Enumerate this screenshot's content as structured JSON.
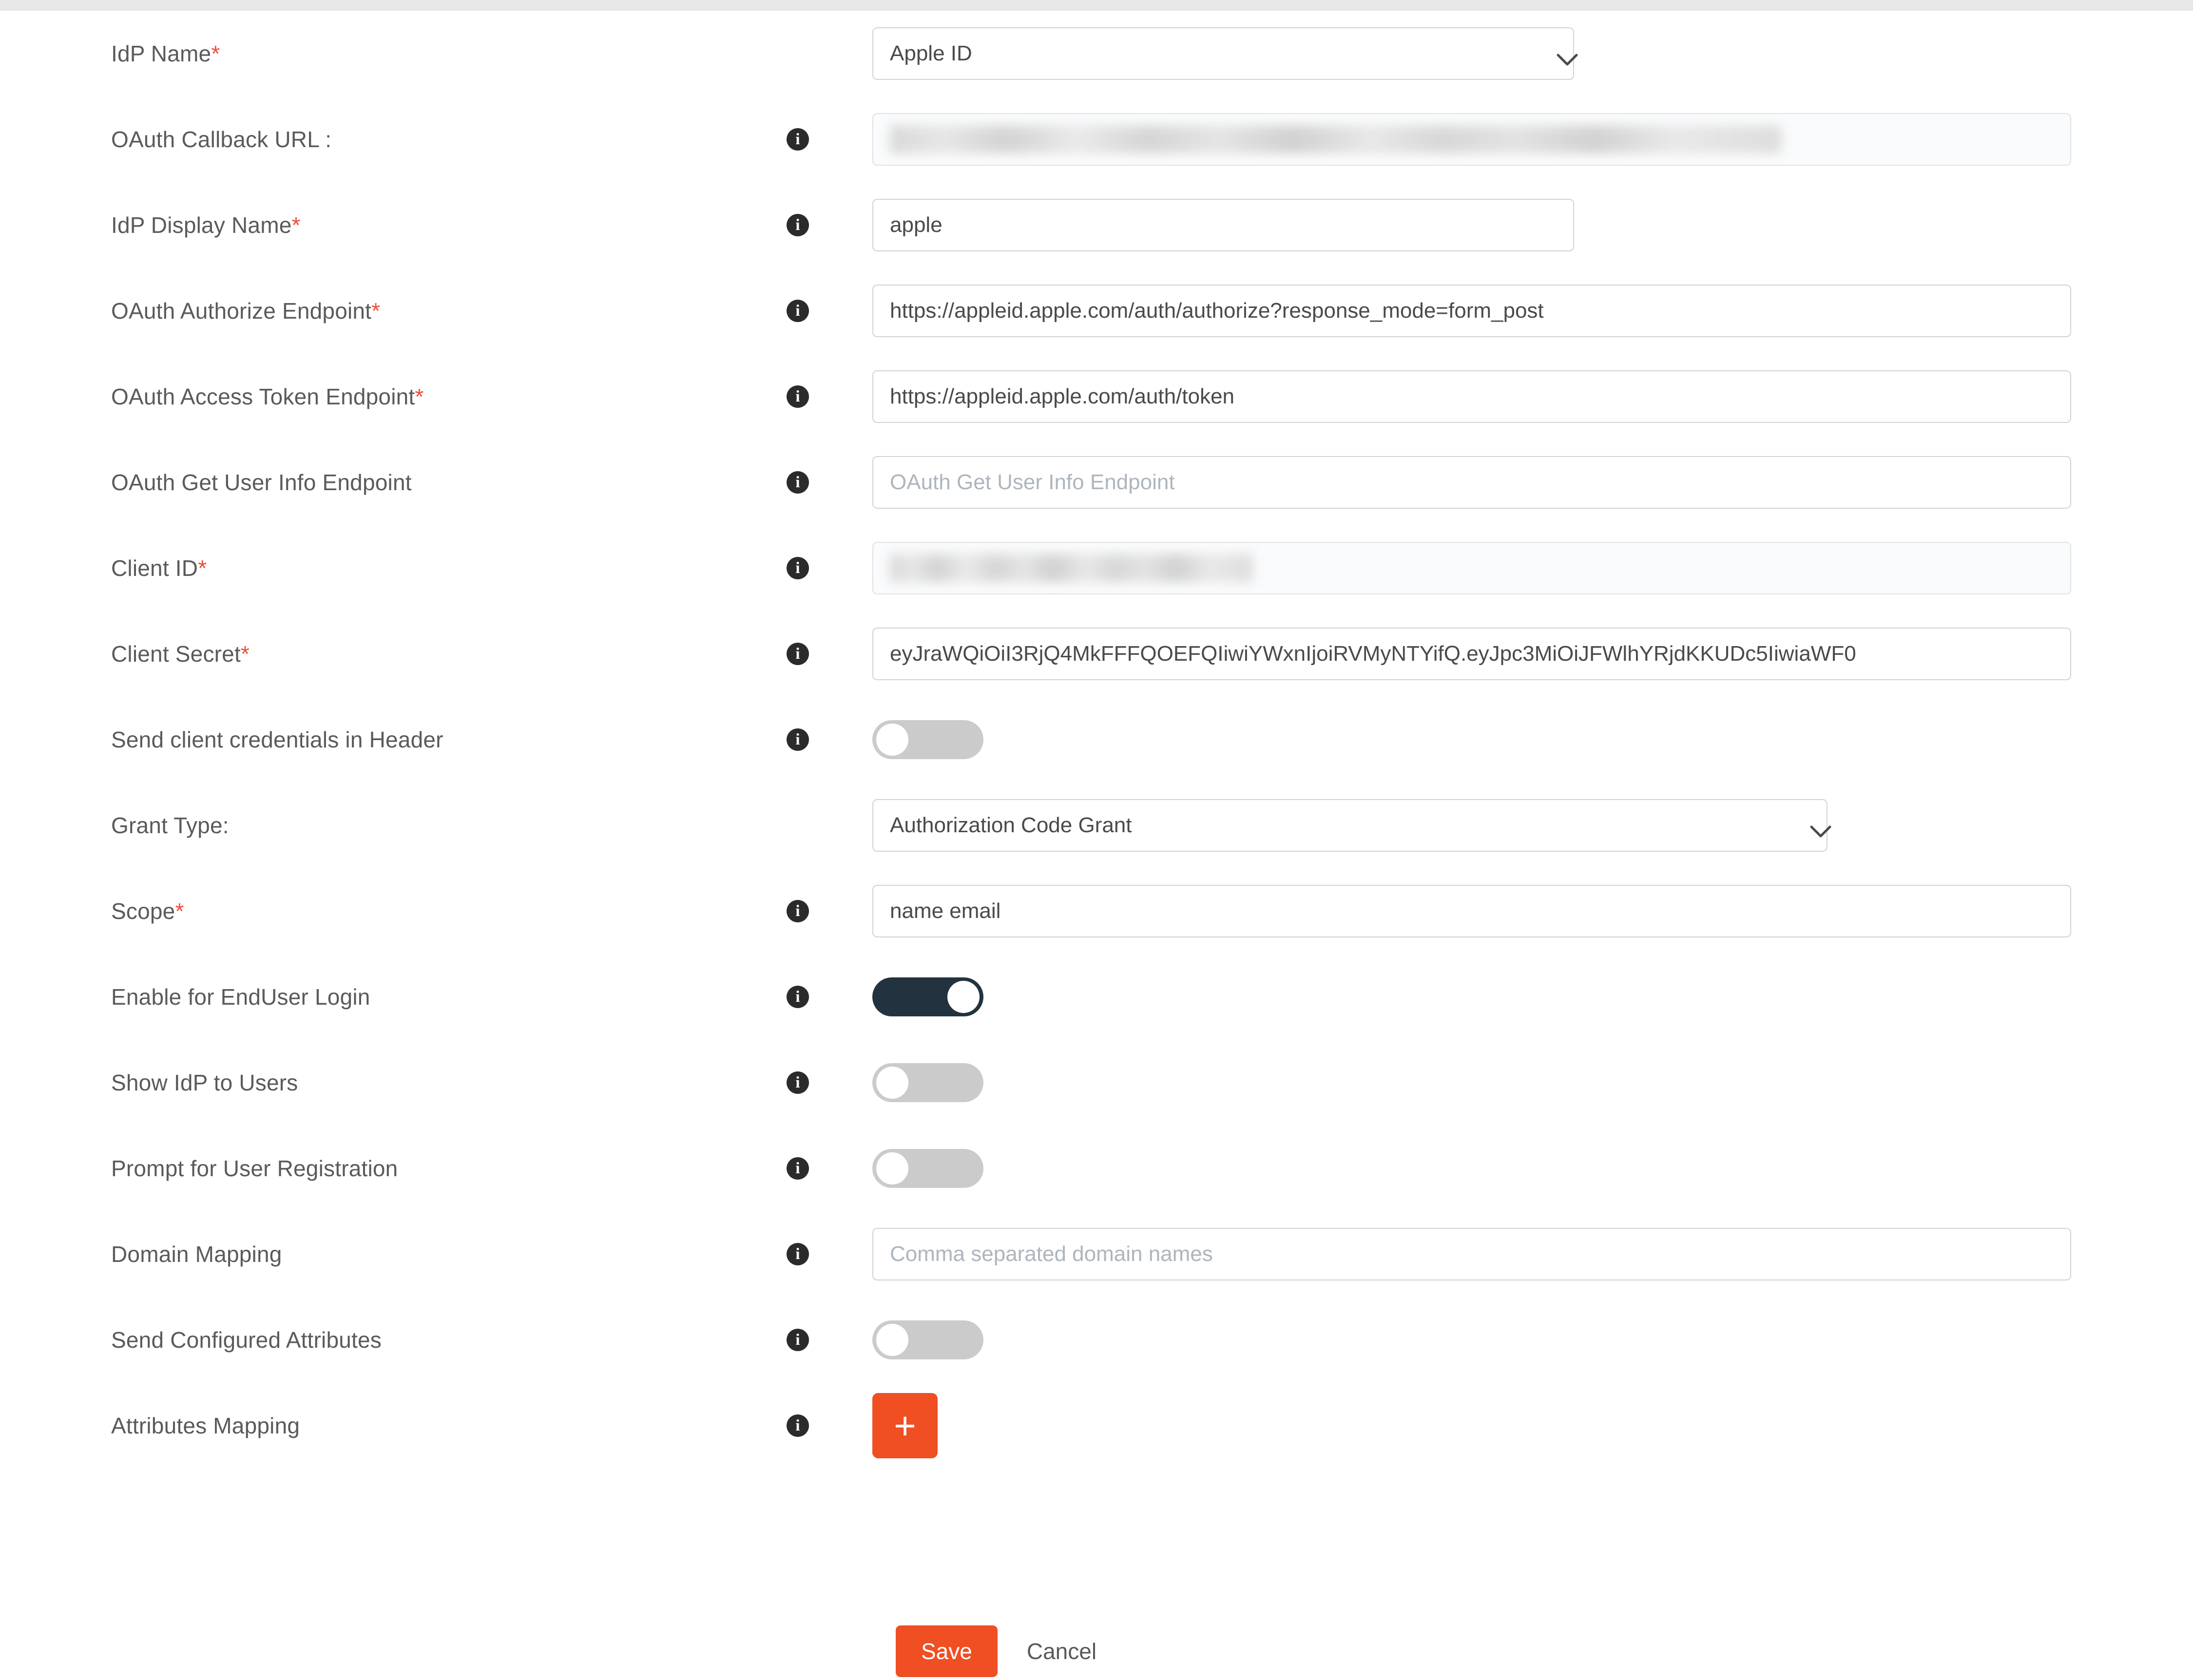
{
  "form": {
    "rows": [
      {
        "label": "IdP Name",
        "required": true,
        "info": false,
        "control": "select",
        "value": "Apple ID",
        "options": [
          "Apple ID"
        ]
      },
      {
        "label": "OAuth Callback URL :",
        "required": false,
        "info": true,
        "control": "redacted-input",
        "value": ""
      },
      {
        "label": "IdP Display Name",
        "required": true,
        "info": true,
        "control": "input-narrow",
        "value": "apple"
      },
      {
        "label": "OAuth Authorize Endpoint",
        "required": true,
        "info": true,
        "control": "input-wide",
        "value": "https://appleid.apple.com/auth/authorize?response_mode=form_post"
      },
      {
        "label": "OAuth Access Token Endpoint",
        "required": true,
        "info": true,
        "control": "input-wide",
        "value": "https://appleid.apple.com/auth/token"
      },
      {
        "label": "OAuth Get User Info Endpoint",
        "required": false,
        "info": true,
        "control": "input-wide-placeholder",
        "value": "",
        "placeholder": "OAuth Get User Info Endpoint"
      },
      {
        "label": "Client ID",
        "required": true,
        "info": true,
        "control": "redacted-input",
        "value": ""
      },
      {
        "label": "Client Secret",
        "required": true,
        "info": true,
        "control": "input-wide",
        "value": "eyJraWQiOiI3RjQ4MkFFFQOEFQIiwiYWxnIjoiRVMyNTYifQ.eyJpc3MiOiJFWlhYRjdKKUDc5IiwiaWF0"
      },
      {
        "label": "Send client credentials in Header",
        "required": false,
        "info": true,
        "control": "toggle",
        "value": false
      },
      {
        "label": "Grant Type:",
        "required": false,
        "info": false,
        "control": "select-grant",
        "value": "Authorization Code Grant",
        "options": [
          "Authorization Code Grant"
        ]
      },
      {
        "label": "Scope",
        "required": true,
        "info": true,
        "control": "input-wide",
        "value": "name email"
      },
      {
        "label": "Enable for EndUser Login",
        "required": false,
        "info": true,
        "control": "toggle",
        "value": true
      },
      {
        "label": "Show IdP to Users",
        "required": false,
        "info": true,
        "control": "toggle",
        "value": false
      },
      {
        "label": "Prompt for User Registration",
        "required": false,
        "info": true,
        "control": "toggle",
        "value": false
      },
      {
        "label": "Domain Mapping",
        "required": false,
        "info": true,
        "control": "input-wide-placeholder",
        "value": "",
        "placeholder": "Comma separated domain names"
      },
      {
        "label": "Send Configured Attributes",
        "required": false,
        "info": true,
        "control": "toggle",
        "value": false
      },
      {
        "label": "Attributes Mapping",
        "required": false,
        "info": true,
        "control": "plus-button",
        "plus_label": "+"
      }
    ]
  },
  "actions": {
    "save_label": "Save",
    "cancel_label": "Cancel"
  },
  "icons": {
    "info": "i"
  },
  "colors": {
    "accent_orange": "#f04e23",
    "toggle_on": "#22333f",
    "toggle_off": "#cbcbcb",
    "required_asterisk": "#ef4d3c",
    "label_text": "#5a5a5a",
    "field_border": "#ced4da",
    "placeholder_text": "#adb5bd"
  }
}
